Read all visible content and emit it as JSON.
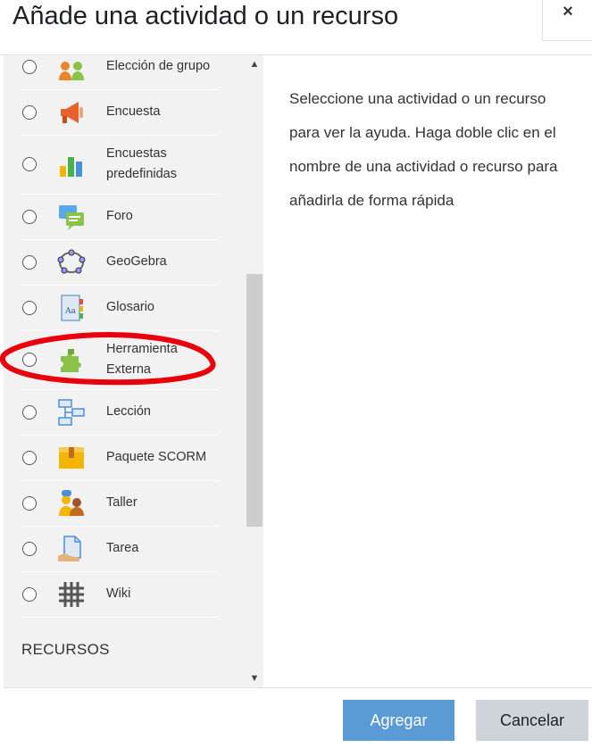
{
  "dialog": {
    "title": "Añade una actividad o un recurso",
    "close_label": "×"
  },
  "activities": [
    {
      "label": "Elección de grupo",
      "icon": "group-choice-icon"
    },
    {
      "label": "Encuesta",
      "icon": "megaphone-icon"
    },
    {
      "label": "Encuestas predefinidas",
      "icon": "bar-chart-icon"
    },
    {
      "label": "Foro",
      "icon": "forum-icon"
    },
    {
      "label": "GeoGebra",
      "icon": "geogebra-icon"
    },
    {
      "label": "Glosario",
      "icon": "glossary-icon"
    },
    {
      "label": "Herramienta Externa",
      "icon": "puzzle-icon"
    },
    {
      "label": "Lección",
      "icon": "lesson-icon"
    },
    {
      "label": "Paquete SCORM",
      "icon": "scorm-package-icon"
    },
    {
      "label": "Taller",
      "icon": "workshop-icon"
    },
    {
      "label": "Tarea",
      "icon": "assignment-icon"
    },
    {
      "label": "Wiki",
      "icon": "wiki-icon"
    }
  ],
  "resources_section": "RECURSOS",
  "help_text": "Seleccione una actividad o un recurso para ver la ayuda. Haga doble clic en el nombre de una actividad o recurso para añadirla de forma rápida",
  "footer": {
    "add_label": "Agregar",
    "cancel_label": "Cancelar"
  },
  "colors": {
    "primary_button": "#5b9bd5",
    "secondary_button": "#ced4da",
    "annotation": "#e8000b"
  }
}
